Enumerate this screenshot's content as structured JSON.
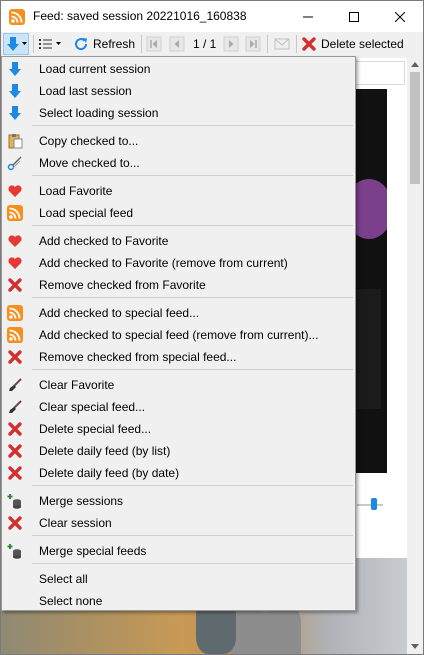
{
  "window": {
    "title": "Feed: saved session 20221016_160838",
    "icon": "rss-feed-icon",
    "controls": [
      "minimize-icon",
      "maximize-icon",
      "close-icon"
    ]
  },
  "toolbar": {
    "refresh_label": "Refresh",
    "page_indicator": "1 / 1",
    "delete_selected_label": "Delete selected",
    "icons": [
      "download-arrow-icon",
      "list-icon",
      "refresh-icon",
      "first-page-icon",
      "prev-page-icon",
      "next-page-icon",
      "last-page-icon",
      "mail-icon",
      "delete-x-icon"
    ]
  },
  "menu": {
    "items": [
      {
        "label": "Load current session",
        "icon": "download-arrow-icon"
      },
      {
        "label": "Load last session",
        "icon": "download-arrow-icon"
      },
      {
        "label": "Select loading session",
        "icon": "download-arrow-icon"
      },
      {
        "label": "Copy checked to...",
        "icon": "clipboard-icon"
      },
      {
        "label": "Move checked to...",
        "icon": "scissors-icon"
      },
      {
        "label": "Load Favorite",
        "icon": "heart-icon"
      },
      {
        "label": "Load special feed",
        "icon": "rss-feed-icon"
      },
      {
        "label": "Add checked to Favorite",
        "icon": "heart-icon"
      },
      {
        "label": "Add checked to Favorite (remove from current)",
        "icon": "heart-icon"
      },
      {
        "label": "Remove checked from Favorite",
        "icon": "red-x-icon"
      },
      {
        "label": "Add checked to special feed...",
        "icon": "rss-feed-icon"
      },
      {
        "label": "Add checked to special feed (remove from current)...",
        "icon": "rss-feed-icon"
      },
      {
        "label": "Remove checked from special feed...",
        "icon": "red-x-icon"
      },
      {
        "label": "Clear Favorite",
        "icon": "brush-icon"
      },
      {
        "label": "Clear special feed...",
        "icon": "brush-icon"
      },
      {
        "label": "Delete special feed...",
        "icon": "red-x-icon"
      },
      {
        "label": "Delete daily feed (by list)",
        "icon": "red-x-icon"
      },
      {
        "label": "Delete daily feed (by date)",
        "icon": "red-x-icon"
      },
      {
        "label": "Merge sessions",
        "icon": "merge-db-icon"
      },
      {
        "label": "Clear session",
        "icon": "red-x-icon"
      },
      {
        "label": "Merge special feeds",
        "icon": "merge-db-icon"
      },
      {
        "label": "Select all",
        "icon": ""
      },
      {
        "label": "Select none",
        "icon": ""
      }
    ]
  },
  "colors": {
    "accent_blue": "#1e88e5",
    "rss_orange": "#f5901e",
    "heart_red": "#e53935",
    "x_red": "#d32f2f"
  }
}
